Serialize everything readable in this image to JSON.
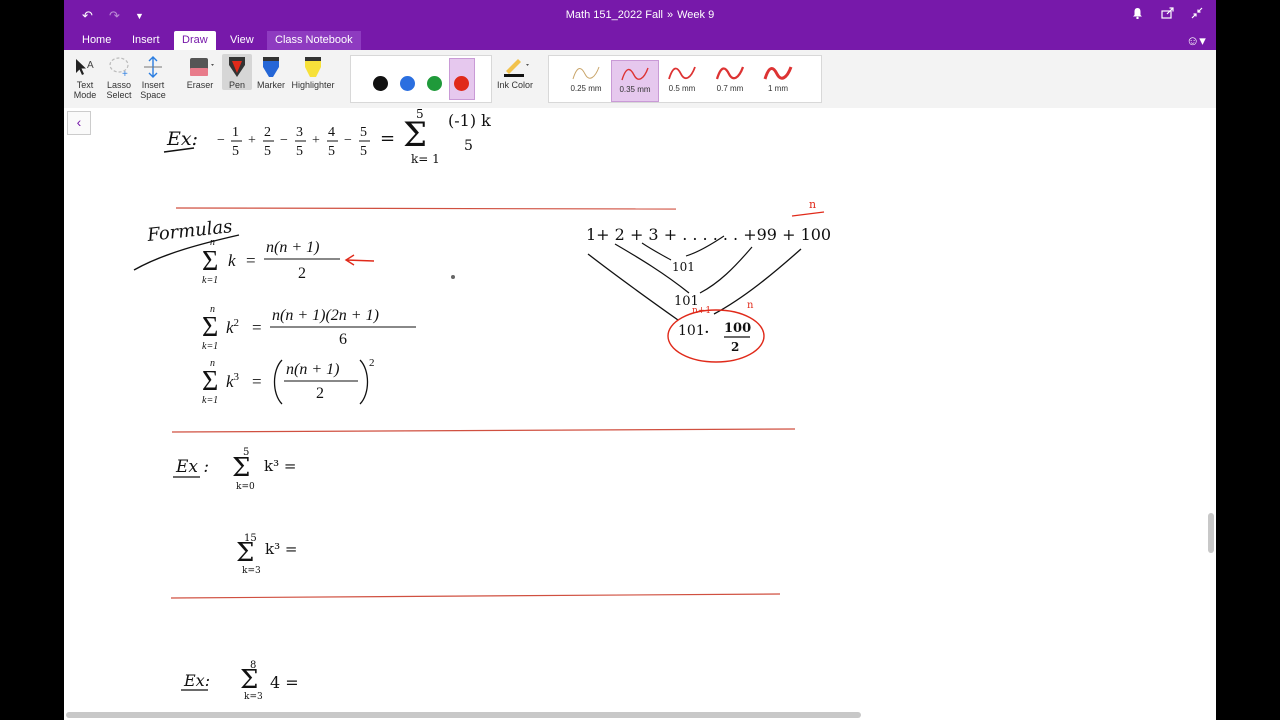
{
  "window": {
    "title_notebook": "Math 151_2022 Fall",
    "title_sep": "»",
    "title_section": "Week 9",
    "undo_icon": "undo-icon",
    "redo_icon": "redo-icon",
    "more_icon": "chevron-down-icon"
  },
  "tabs": [
    {
      "label": "Home"
    },
    {
      "label": "Insert"
    },
    {
      "label": "Draw"
    },
    {
      "label": "View"
    },
    {
      "label": "Class Notebook"
    }
  ],
  "toolbar": {
    "text_mode": [
      "Text",
      "Mode"
    ],
    "lasso_select": [
      "Lasso",
      "Select"
    ],
    "insert_space": [
      "Insert",
      "Space"
    ],
    "eraser": "Eraser",
    "pen": "Pen",
    "marker": "Marker",
    "highlighter": "Highlighter",
    "ink_color": "Ink Color",
    "colors": [
      "#111111",
      "#2b6fe0",
      "#1f9a3a",
      "#e02a1a"
    ],
    "thicknesses": [
      "0.25 mm",
      "0.35 mm",
      "0.5 mm",
      "0.7 mm",
      "1 mm"
    ],
    "selected_thickness": "0.35 mm"
  },
  "notes": {
    "ex1_label": "Ex:",
    "ex1_lhs": [
      "−",
      "1",
      "5",
      "+",
      "2",
      "5",
      "−",
      "3",
      "5",
      "+",
      "4",
      "5",
      "−",
      "5",
      "5"
    ],
    "ex1_eq": "=",
    "ex1_sum_top": "5",
    "ex1_sum_bottom": "k= 1",
    "ex1_term_num": "(-1) k",
    "ex1_term_den": "5",
    "formulas_label": "Formulas",
    "f1_num": "n(n + 1)",
    "f1_den": "2",
    "f2_num": "n(n + 1)(2n + 1)",
    "f2_den": "6",
    "f3_num": "n(n + 1)",
    "f3_den": "2",
    "sum_top": "n",
    "sum_bottom": "k=1",
    "gauss_row": "1+ 2 + 3 + . . . . . . +99 + 100",
    "gauss_n": "n",
    "gauss_101a": "101",
    "gauss_101b": "101",
    "gauss_n1": "n+1",
    "gauss_n2": "n",
    "gauss_result_a": "101",
    "gauss_result_dot": "·",
    "gauss_result_num": "100",
    "gauss_result_den": "2",
    "ex2_label": "Ex :",
    "ex2_top": "5",
    "ex2_bottom": "k=0",
    "ex2_term": "k³ =",
    "ex3_top": "15",
    "ex3_bottom": "k=3",
    "ex3_term": "k³ =",
    "ex4_label": "Ex:",
    "ex4_top": "8",
    "ex4_bottom": "k=3",
    "ex4_term": "4 ="
  }
}
